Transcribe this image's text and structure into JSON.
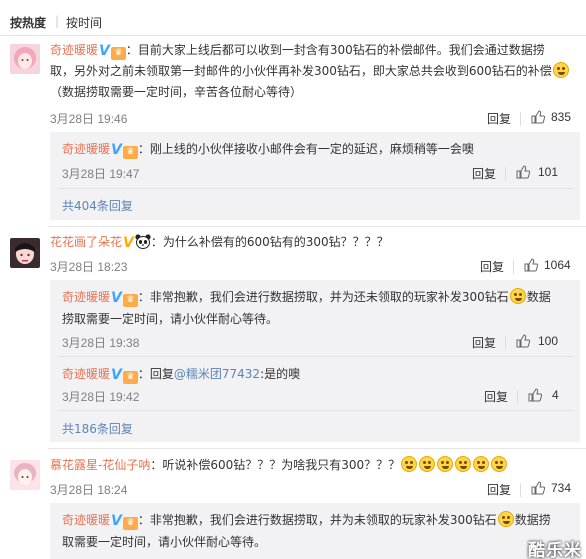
{
  "sort": {
    "hot": "按热度",
    "time": "按时间"
  },
  "labels": {
    "reply": "回复"
  },
  "colors": {
    "username": "#eb7350",
    "link": "#5e84b5",
    "vip_blue": "#3da5ff",
    "vip_yellow": "#ffae00",
    "sub_bg": "#f2f2f5"
  },
  "icons": {
    "like": "thumbs-up-icon",
    "verified": "v-badge-icon",
    "level": "level-badge-icon",
    "emoji": "emoji-icon",
    "panda": "panda-icon"
  },
  "comments": [
    {
      "user": "奇迹暖暖",
      "text1": "：目前大家上线后都可以收到一封含有300钻石的补偿邮件。我们会通过数据捞",
      "text2": "取，另外对之前未领取第一封邮件的小伙伴再补发300钻石，即大家总共会收到600钻石的补偿",
      "text3": "（数据捞取需要一定时间，辛苦各位耐心等待）",
      "time": "3月28日 19:46",
      "likes": "835",
      "replies": [
        {
          "user": "奇迹暖暖",
          "text": "：刚上线的小伙伴接收小邮件会有一定的延迟，麻烦稍等一会噢",
          "time": "3月28日 19:47",
          "likes": "101"
        }
      ],
      "more": "共404条回复"
    },
    {
      "user": "花花画了朵花",
      "text1": "：为什么补偿有的600钻有的300钻？？？？",
      "time": "3月28日 18:23",
      "likes": "1064",
      "replies": [
        {
          "user": "奇迹暖暖",
          "text1": "：非常抱歉，我们会进行数据捞取，并为还未领取的玩家补发300钻石",
          "text1b": "数据",
          "text2": "捞取需要一定时间，请小伙伴耐心等待。",
          "time": "3月28日 19:38",
          "likes": "100"
        },
        {
          "user": "奇迹暖暖",
          "text_pre": "：回复",
          "mention": "@糯米团77432",
          "text_post": ":是的噢",
          "time": "3月28日 19:42",
          "likes": "4"
        }
      ],
      "more": "共186条回复"
    },
    {
      "user": "慕花露星-花仙子呐",
      "text1": "：听说补偿600钻？？？为啥我只有300？？？",
      "time": "3月28日 18:24",
      "likes": "734",
      "replies": [
        {
          "user": "奇迹暖暖",
          "text1": "：非常抱歉，我们会进行数据捞取，并为未领取的玩家补发300钻石",
          "text1b": "数据捞",
          "text2": "取需要一定时间，请小伙伴耐心等待。"
        }
      ]
    }
  ],
  "watermark": "酷乐米"
}
